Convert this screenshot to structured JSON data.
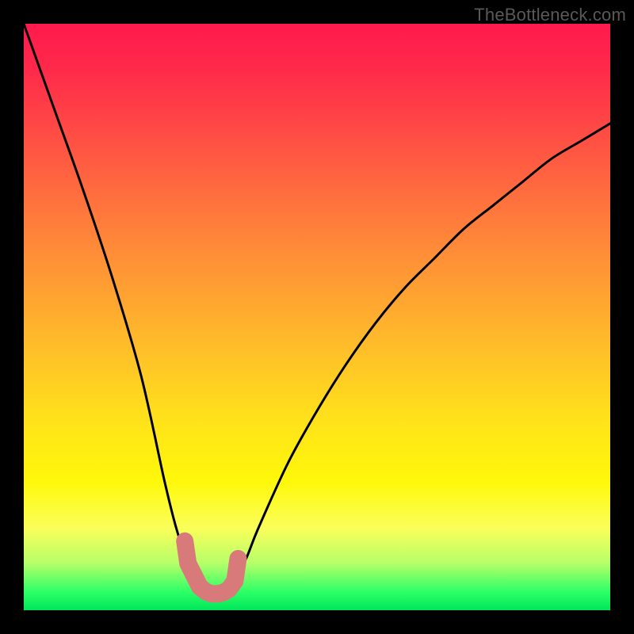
{
  "attribution": "TheBottleneck.com",
  "colors": {
    "frame": "#000000",
    "curve": "#000000",
    "marker": "#d97a7a",
    "gradient_top": "#ff1a4d",
    "gradient_bottom": "#00e65a"
  },
  "chart_data": {
    "type": "line",
    "title": "",
    "xlabel": "",
    "ylabel": "",
    "xlim": [
      0,
      100
    ],
    "ylim": [
      0,
      100
    ],
    "grid": false,
    "legend": false,
    "series": [
      {
        "name": "bottleneck-curve",
        "x": [
          0,
          5,
          10,
          15,
          20,
          24,
          26,
          28,
          30,
          31,
          32,
          33,
          34,
          35,
          36,
          38,
          40,
          45,
          50,
          55,
          60,
          65,
          70,
          75,
          80,
          85,
          90,
          95,
          100
        ],
        "y": [
          100,
          86,
          72,
          57,
          40,
          22,
          14,
          8,
          4,
          3.2,
          2.8,
          2.8,
          3.0,
          3.6,
          5,
          9,
          14,
          25,
          34,
          42,
          49,
          55,
          60,
          65,
          69,
          73,
          77,
          80,
          83
        ]
      }
    ],
    "markers": [
      {
        "name": "flat-marker",
        "x_range": [
          30,
          35
        ],
        "y": 3
      }
    ],
    "annotations": []
  }
}
